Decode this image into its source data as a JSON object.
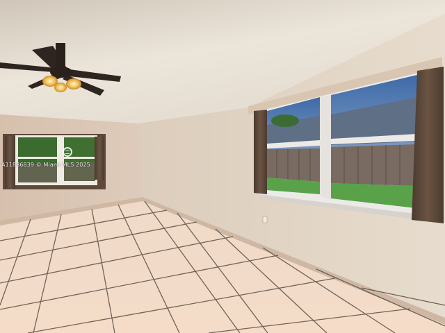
{
  "photo": {
    "watermark": {
      "listing_id": "A11836839",
      "copyright_text": "© Miami MLS 2025",
      "logo_icon": "mls-ring-logo-icon"
    },
    "colors": {
      "ceiling": "#e6e0d6",
      "right_wall": "#e3d6c6",
      "left_wall": "#dcc8b6",
      "floor_tile": "#f1d9c6",
      "grout": "#5b4e45",
      "curtain": "#5e4838",
      "window_frame": "#eceae7",
      "sky": "#6d8fbf",
      "fence": "#7a6b62",
      "grass": "#5aa24a"
    }
  }
}
